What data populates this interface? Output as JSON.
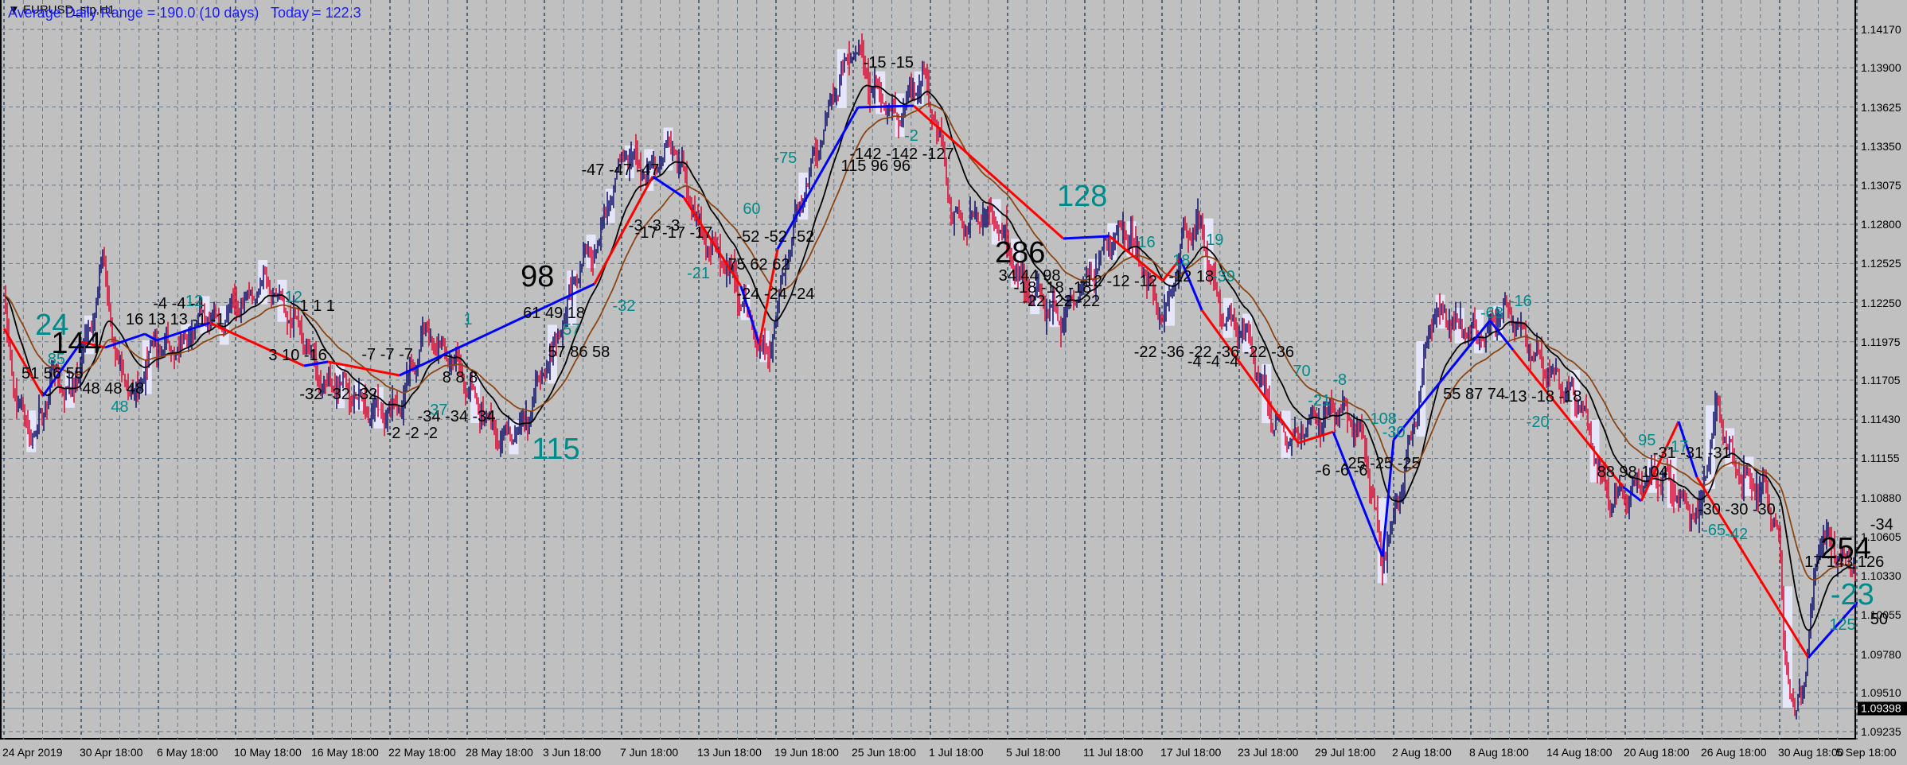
{
  "header": {
    "symbol_label": "EURUSD_stp,H1",
    "adr_text": "Average Daily Range = 190.0 (10 days)   Today = 122.3"
  },
  "price_axis": {
    "ticks": [
      "1.14170",
      "1.13900",
      "1.13625",
      "1.13350",
      "1.13075",
      "1.12800",
      "1.12525",
      "1.12250",
      "1.11975",
      "1.11705",
      "1.11430",
      "1.11155",
      "1.10880",
      "1.10605",
      "1.10330",
      "1.10055",
      "1.09780",
      "1.09510",
      "1.09235"
    ],
    "current_price": "1.09398"
  },
  "time_axis": {
    "labels": [
      "24 Apr 2019",
      "30 Apr 18:00",
      "6 May 18:00",
      "10 May 18:00",
      "16 May 18:00",
      "22 May 18:00",
      "28 May 18:00",
      "3 Jun 18:00",
      "7 Jun 18:00",
      "13 Jun 18:00",
      "19 Jun 18:00",
      "25 Jun 18:00",
      "1 Jul 18:00",
      "5 Jul 18:00",
      "11 Jul 18:00",
      "17 Jul 18:00",
      "23 Jul 18:00",
      "29 Jul 18:00",
      "2 Aug 18:00",
      "8 Aug 18:00",
      "14 Aug 18:00",
      "20 Aug 18:00",
      "26 Aug 18:00",
      "30 Aug 18:00",
      "5 Sep 18:00"
    ]
  },
  "colors": {
    "background": "#c0c0c0",
    "bull_bar": "#191970",
    "bear_bar": "#dc143c",
    "zigzag_up": "#0000ff",
    "zigzag_down": "#ff0000",
    "ma_fast": "#000000",
    "ma_slow": "#8b4513",
    "annotation_teal": "#008b8b",
    "adr_text": "#1a1aff"
  },
  "annotations": [
    "24",
    "144",
    "85",
    "51 56 55",
    "48 48 48",
    "48",
    "16 13 13 -1 -1",
    "-4 -4 -4",
    "12",
    "3 10 -16",
    "12",
    "1 1 1",
    "-32 -32 -32",
    "-7 -7 -7",
    "8 8 8",
    "1",
    "-34 -34 -34",
    "37",
    "-2 -2 -2",
    "115",
    "98",
    "61 49 18",
    "57",
    "-32",
    "57 86 58",
    "-47 -47 -47",
    "-3 -3 -3",
    "-17 -17 -17",
    "60",
    "-21",
    "75 62 62",
    "-52 -52 -52",
    "-24 -24 -24",
    "-75",
    "-15 -15",
    "-142 -142 -127",
    "115 96 96",
    "-2",
    "128",
    "286",
    "34 44 98",
    "-18 -18 -18",
    "-22 -22 -22",
    "-12 -12 -12",
    "16",
    "18",
    "-12 18",
    "19",
    "-39",
    "-22 -36 -22 -36 -22 -36",
    "-4 -4 -4",
    "70",
    "-8",
    "-21",
    "-108",
    "-30",
    "-6 -6 -6",
    "-25 -25 -25",
    "55 87 74",
    "-68",
    "-16",
    "-13 -18 -18",
    "-20",
    "88 98 104",
    "95",
    "-17",
    "-31 -31 -31",
    "-30 -30 -30",
    "-65",
    "-42",
    "254",
    "17 143 126",
    "-23",
    "125",
    "50",
    "-34"
  ],
  "chart_data": {
    "type": "line",
    "title": "EURUSD_stp,H1",
    "xlabel": "",
    "ylabel": "",
    "x_unit": "date-label intervals from 24 Apr 2019",
    "ylim": [
      1.0915,
      1.1437
    ],
    "price_path": [
      [
        0,
        1.1224
      ],
      [
        0.16,
        1.1148
      ],
      [
        0.4,
        1.1131
      ],
      [
        0.64,
        1.1182
      ],
      [
        0.88,
        1.1156
      ],
      [
        1.13,
        1.1207
      ],
      [
        1.29,
        1.1259
      ],
      [
        1.45,
        1.119
      ],
      [
        1.69,
        1.1156
      ],
      [
        1.93,
        1.119
      ],
      [
        2.25,
        1.1199
      ],
      [
        2.57,
        1.1216
      ],
      [
        2.81,
        1.1207
      ],
      [
        3.05,
        1.1233
      ],
      [
        3.38,
        1.1237
      ],
      [
        3.62,
        1.1216
      ],
      [
        3.86,
        1.1207
      ],
      [
        4.18,
        1.1165
      ],
      [
        4.66,
        1.1156
      ],
      [
        5.14,
        1.1148
      ],
      [
        5.47,
        1.1207
      ],
      [
        5.79,
        1.119
      ],
      [
        6.11,
        1.1148
      ],
      [
        6.43,
        1.1135
      ],
      [
        6.75,
        1.1139
      ],
      [
        7.07,
        1.1182
      ],
      [
        7.4,
        1.125
      ],
      [
        7.72,
        1.1267
      ],
      [
        8.04,
        1.1335
      ],
      [
        8.36,
        1.1318
      ],
      [
        8.68,
        1.1331
      ],
      [
        9.0,
        1.1284
      ],
      [
        9.49,
        1.1233
      ],
      [
        9.89,
        1.119
      ],
      [
        10.13,
        1.125
      ],
      [
        10.45,
        1.1318
      ],
      [
        10.77,
        1.1378
      ],
      [
        11.01,
        1.1403
      ],
      [
        11.25,
        1.1374
      ],
      [
        11.58,
        1.1361
      ],
      [
        11.9,
        1.1378
      ],
      [
        12.14,
        1.1335
      ],
      [
        12.3,
        1.1288
      ],
      [
        12.86,
        1.128
      ],
      [
        13.18,
        1.1246
      ],
      [
        13.67,
        1.1207
      ],
      [
        13.99,
        1.1242
      ],
      [
        14.31,
        1.1267
      ],
      [
        14.55,
        1.1271
      ],
      [
        14.79,
        1.125
      ],
      [
        15.03,
        1.1216
      ],
      [
        15.27,
        1.1267
      ],
      [
        15.51,
        1.1276
      ],
      [
        15.76,
        1.1224
      ],
      [
        16.08,
        1.1199
      ],
      [
        16.4,
        1.1148
      ],
      [
        16.72,
        1.1131
      ],
      [
        17.04,
        1.1139
      ],
      [
        17.36,
        1.1156
      ],
      [
        17.6,
        1.1131
      ],
      [
        17.85,
        1.1037
      ],
      [
        18.01,
        1.1071
      ],
      [
        18.25,
        1.1139
      ],
      [
        18.49,
        1.1216
      ],
      [
        18.81,
        1.1207
      ],
      [
        19.13,
        1.1207
      ],
      [
        19.45,
        1.1216
      ],
      [
        19.69,
        1.1199
      ],
      [
        20.02,
        1.1182
      ],
      [
        20.42,
        1.1148
      ],
      [
        20.74,
        1.1097
      ],
      [
        21.06,
        1.1088
      ],
      [
        21.54,
        1.1105
      ],
      [
        21.95,
        1.1071
      ],
      [
        22.19,
        1.1148
      ],
      [
        22.43,
        1.1114
      ],
      [
        22.83,
        1.1088
      ],
      [
        23.0,
        1.1054
      ],
      [
        23.05,
        1.0985
      ],
      [
        23.2,
        1.0935
      ],
      [
        23.3,
        1.096
      ],
      [
        23.45,
        1.103
      ],
      [
        23.55,
        1.1063
      ],
      [
        23.7,
        1.1045
      ],
      [
        23.85,
        1.104
      ],
      [
        24.0,
        1.1045
      ]
    ]
  }
}
